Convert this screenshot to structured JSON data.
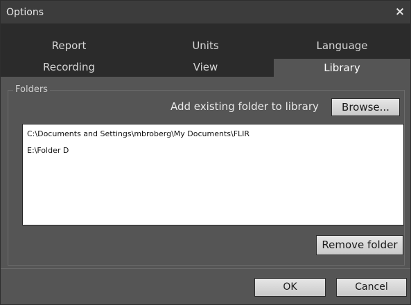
{
  "window": {
    "title": "Options",
    "close_icon": "close-icon"
  },
  "tabs": {
    "row1": [
      {
        "label": "Report"
      },
      {
        "label": "Units"
      },
      {
        "label": "Language"
      }
    ],
    "row2": [
      {
        "label": "Recording"
      },
      {
        "label": "View"
      },
      {
        "label": "Library",
        "active": true
      }
    ]
  },
  "library": {
    "group_label": "Folders",
    "add_label": "Add existing folder to library",
    "browse_label": "Browse...",
    "folders": [
      "C:\\Documents and Settings\\mbroberg\\My Documents\\FLIR",
      "E:\\Folder D"
    ],
    "remove_label": "Remove folder"
  },
  "footer": {
    "ok_label": "OK",
    "cancel_label": "Cancel"
  },
  "colors": {
    "dialog_bg": "#555555",
    "tab_bar_bg": "#2b2b2b",
    "active_tab_bg": "#555555",
    "title_bg": "#3c3c3c"
  }
}
